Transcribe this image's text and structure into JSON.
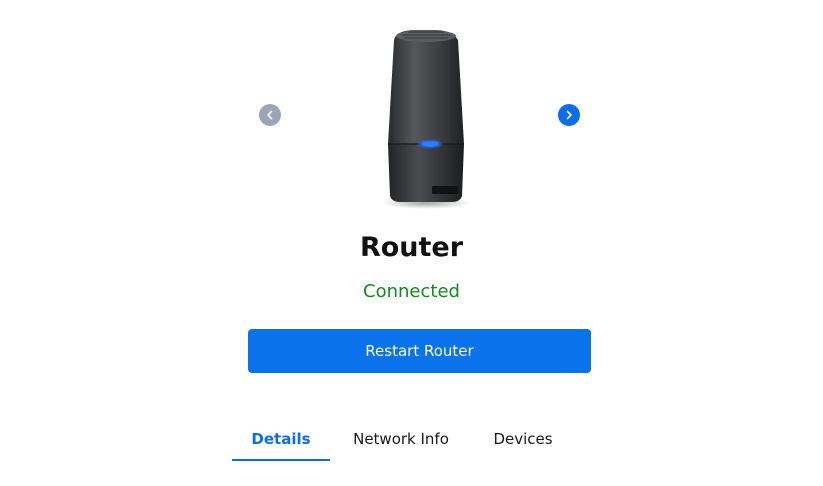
{
  "carousel": {
    "prev_icon": "chevron-left-icon",
    "next_icon": "chevron-right-icon",
    "image_icon": "router-image"
  },
  "device": {
    "name": "Router",
    "status": "Connected",
    "status_color": "#138a1e"
  },
  "actions": {
    "restart_label": "Restart Router",
    "accent_color": "#0a73eb"
  },
  "tabs": [
    {
      "label": "Details",
      "active": true
    },
    {
      "label": "Network Info",
      "active": false
    },
    {
      "label": "Devices",
      "active": false
    }
  ]
}
